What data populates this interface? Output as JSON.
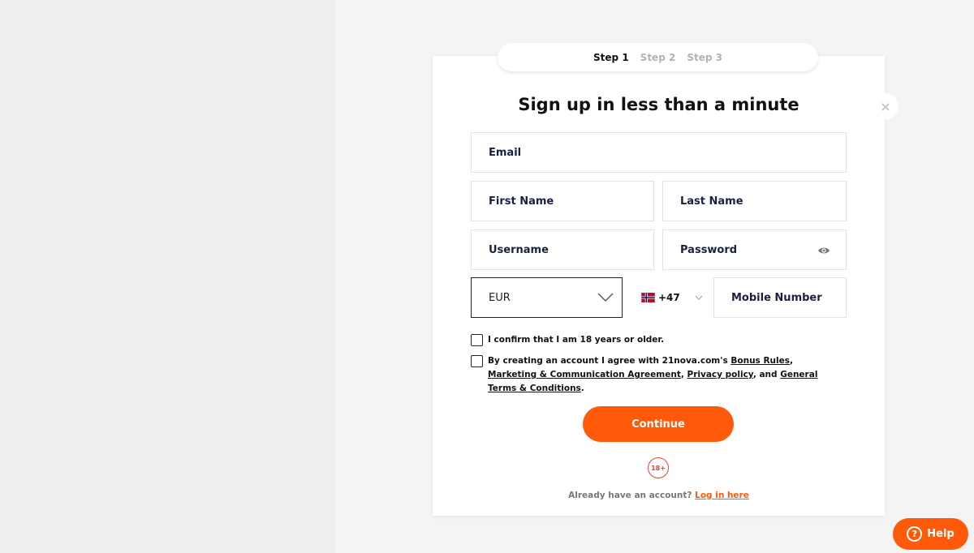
{
  "steps": [
    {
      "label": "Step 1",
      "active": true
    },
    {
      "label": "Step 2",
      "active": false
    },
    {
      "label": "Step 3",
      "active": false
    }
  ],
  "close_symbol": "×",
  "title": "Sign up in less than a minute",
  "fields": {
    "email": "Email",
    "first_name": "First Name",
    "last_name": "Last Name",
    "username": "Username",
    "password": "Password",
    "currency": "EUR",
    "country_code": "+47",
    "mobile": "Mobile Number"
  },
  "checkboxes": {
    "age": "I confirm that I am 18 years or older.",
    "terms_prefix": "By creating an account I agree with 21nova.com's ",
    "bonus_rules": "Bonus Rules",
    "comma1": ", ",
    "marketing": "Marketing & Communication Agreement",
    "comma2": ", ",
    "privacy": "Privacy policy",
    "and": ", and ",
    "general_terms": "General Terms & Conditions",
    "period": "."
  },
  "continue_label": "Continue",
  "age_badge": "18+",
  "login": {
    "prompt": "Already have an account?",
    "link": "Log in here"
  },
  "help_label": "Help",
  "help_icon_glyph": "?",
  "icons": [
    "close-icon",
    "eye-icon",
    "chevron-down-icon",
    "norway-flag-icon",
    "help-icon"
  ],
  "colors": {
    "accent": "#ff5a0a",
    "badge": "#e8463a",
    "label_text": "#1a2040"
  }
}
